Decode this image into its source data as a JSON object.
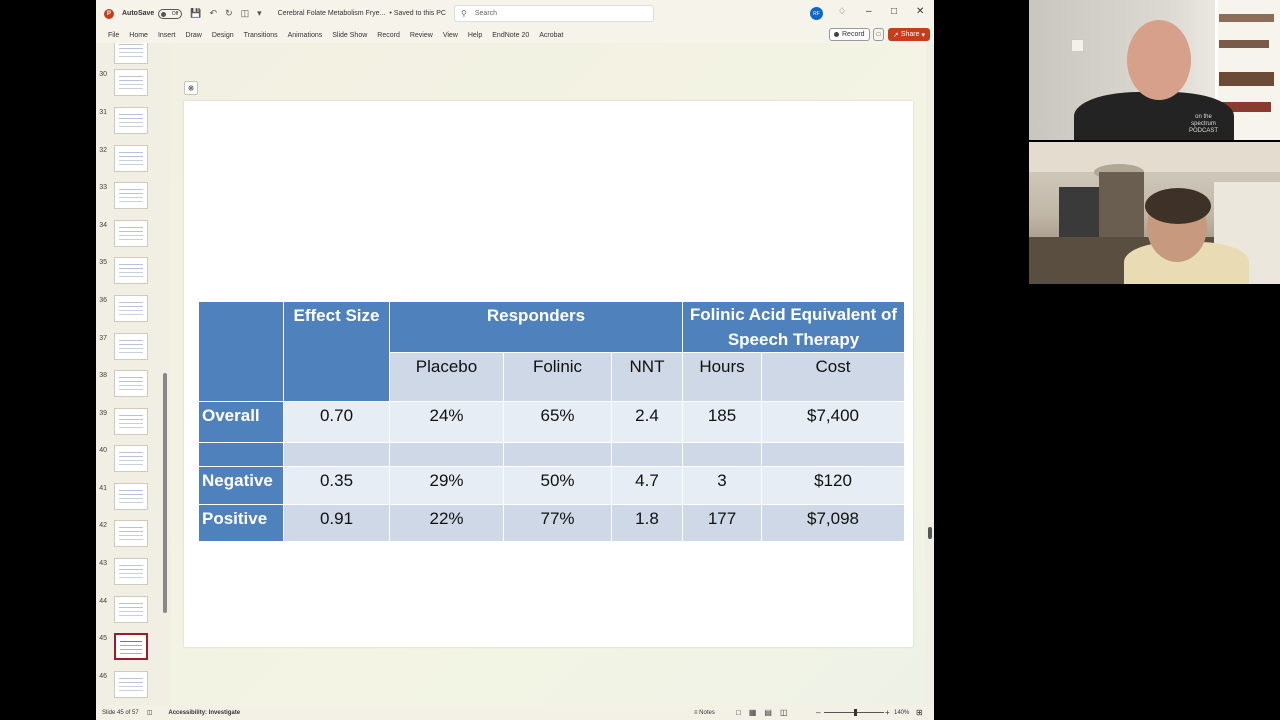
{
  "titlebar": {
    "autosave_label": "AutoSave",
    "autosave_state": "Off",
    "doc_title": "Cerebral Folate Metabolism Frye...",
    "saved_status": "• Saved to this PC",
    "search_placeholder": "Search",
    "user_initials": "RF"
  },
  "ribbon": {
    "tabs": [
      "File",
      "Home",
      "Insert",
      "Draw",
      "Design",
      "Transitions",
      "Animations",
      "Slide Show",
      "Record",
      "Review",
      "View",
      "Help",
      "EndNote 20",
      "Acrobat"
    ],
    "record_label": "Record",
    "share_label": "Share"
  },
  "thumbnails": {
    "numbers": [
      "30",
      "31",
      "32",
      "33",
      "34",
      "35",
      "36",
      "37",
      "38",
      "39",
      "40",
      "41",
      "42",
      "43",
      "44",
      "45",
      "46"
    ],
    "selected": "45"
  },
  "table": {
    "header1": {
      "effect_size": "Effect Size",
      "responders": "Responders",
      "folinic_equiv": "Folinic Acid Equivalent of Speech Therapy"
    },
    "header2": {
      "placebo": "Placebo",
      "folinic": "Folinic",
      "nnt": "NNT",
      "hours": "Hours",
      "cost": "Cost"
    },
    "rows": [
      {
        "label": "Overall",
        "effect_size": "0.70",
        "placebo": "24%",
        "folinic": "65%",
        "nnt": "2.4",
        "hours": "185",
        "cost": "$7,400"
      },
      {
        "label": "Negative",
        "effect_size": "0.35",
        "placebo": "29%",
        "folinic": "50%",
        "nnt": "4.7",
        "hours": "3",
        "cost": "$120"
      },
      {
        "label": "Positive",
        "effect_size": "0.91",
        "placebo": "22%",
        "folinic": "77%",
        "nnt": "1.8",
        "hours": "177",
        "cost": "$7,098"
      }
    ]
  },
  "statusbar": {
    "slide_count": "Slide 45 of 57",
    "accessibility": "Accessibility: Investigate",
    "notes_label": "Notes",
    "zoom": "140%"
  },
  "video_tiles": {
    "tile1_shirt_text": [
      "on the",
      "spectrum",
      "PODCAST"
    ]
  },
  "colors": {
    "table_header_blue": "#4f81bd",
    "table_light": "#e7edf4",
    "table_mid": "#ced8e6",
    "accent_red": "#c43e1c"
  }
}
